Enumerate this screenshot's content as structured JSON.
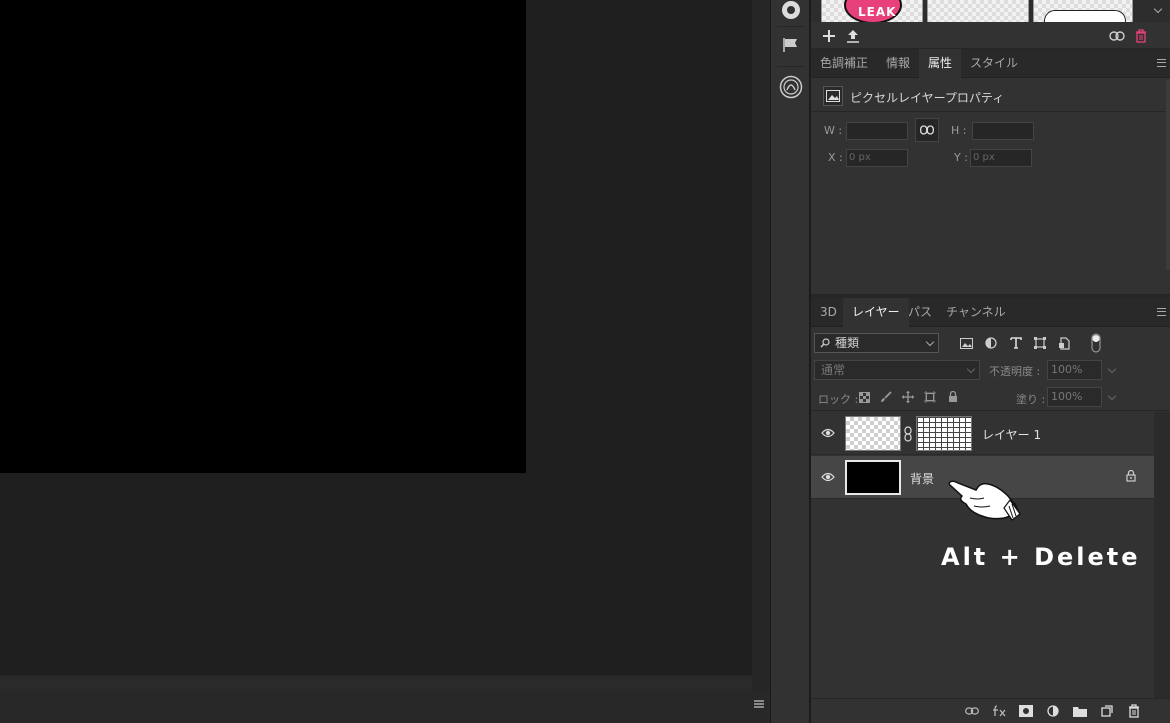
{
  "library": {
    "thumb_caption": "LEAK"
  },
  "properties_tabs": [
    "色調補正",
    "情報",
    "属性",
    "スタイル"
  ],
  "properties": {
    "title": "ピクセルレイヤープロパティ",
    "w_label": "W :",
    "h_label": "H :",
    "x_label": "X :",
    "y_label": "Y :",
    "w_value": "",
    "h_value": "",
    "x_placeholder": "0 px",
    "y_placeholder": "0 px"
  },
  "layers_tabs": [
    "3D",
    "レイヤー",
    "パス",
    "チャンネル"
  ],
  "layers": {
    "filter_kind": "種類",
    "blend_mode": "通常",
    "opacity_label": "不透明度 :",
    "opacity_value": "100%",
    "lock_label": "ロック :",
    "fill_label": "塗り :",
    "fill_value": "100%",
    "items": [
      {
        "name": "レイヤー 1",
        "visible": true,
        "selected": false,
        "locked": false
      },
      {
        "name": "背景",
        "visible": true,
        "selected": true,
        "locked": true
      }
    ]
  },
  "annotation": "Alt + Delete",
  "colors": {
    "canvas_fill": "#000000",
    "panel_bg": "#323232",
    "selected_row": "#464646",
    "accent_pink": "#e8407a"
  }
}
